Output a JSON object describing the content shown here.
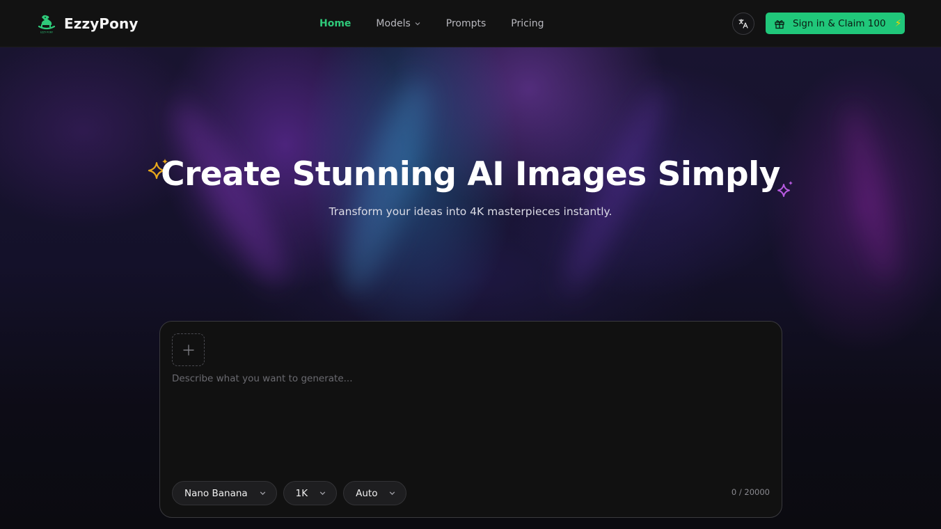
{
  "header": {
    "brand": "EzzyPony",
    "nav": [
      {
        "label": "Home",
        "active": true
      },
      {
        "label": "Models",
        "has_dropdown": true
      },
      {
        "label": "Prompts"
      },
      {
        "label": "Pricing"
      }
    ],
    "language_icon": "translate-icon",
    "signin_label": "Sign in & Claim 100",
    "signin_gift_icon": "gift-icon",
    "signin_bolt": "⚡"
  },
  "hero": {
    "title": "Create Stunning AI Images Simply",
    "subtitle": "Transform your ideas into 4K masterpieces instantly."
  },
  "prompt_card": {
    "upload_icon": "plus-icon",
    "placeholder": "Describe what you want to generate...",
    "value": "",
    "model": "Nano Banana",
    "resolution": "1K",
    "aspect": "Auto",
    "counter": "0 / 20000"
  },
  "colors": {
    "accent": "#20c77a",
    "nav_active": "#2fc97a",
    "sparkle_left": "#e8a81c",
    "sparkle_right": "#b75ae0",
    "header_bg": "#121212",
    "card_bg": "#111111"
  }
}
